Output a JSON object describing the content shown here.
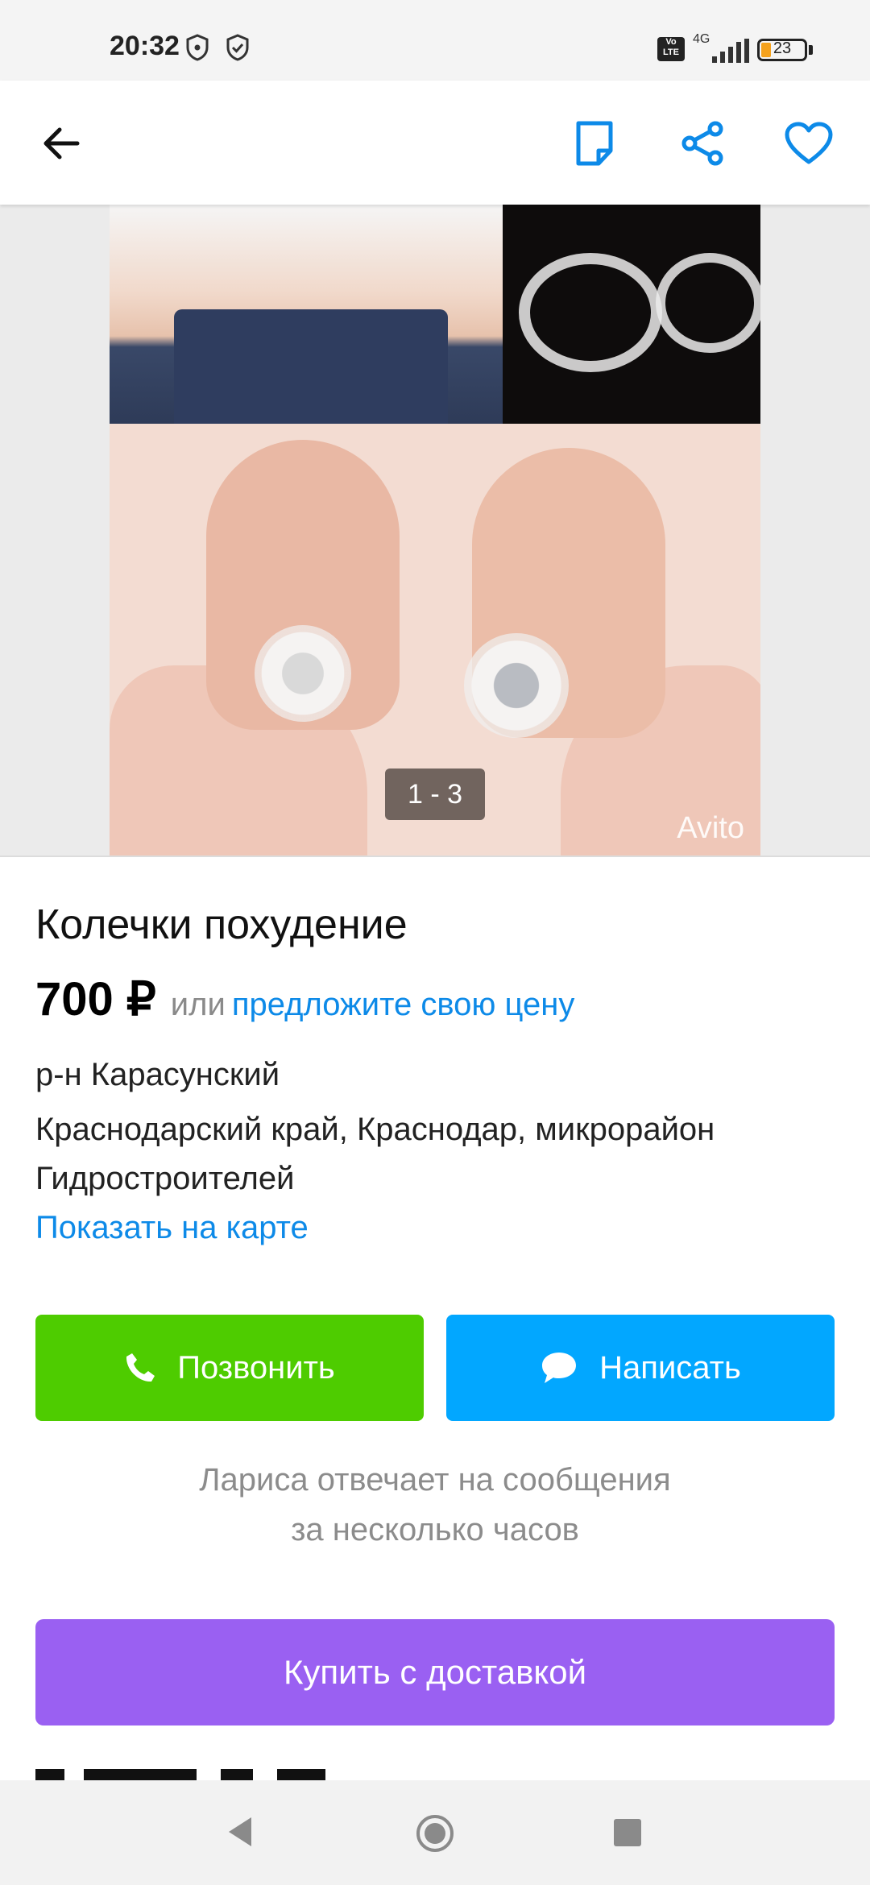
{
  "status_bar": {
    "time": "20:32",
    "network": "4G",
    "volte": "Vo LTE",
    "battery": "23",
    "battery_level": 0.23
  },
  "app_bar": {
    "icons": [
      "back-arrow-icon",
      "note-icon",
      "share-icon",
      "heart-icon"
    ],
    "accent": "#0d8ae8"
  },
  "gallery": {
    "counter": "1 - 3",
    "watermark": "Avito"
  },
  "listing": {
    "title": "Колечки похудение",
    "price": "700 ₽",
    "or_text": "или",
    "offer_link": "предложите свою цену",
    "district": "р-н Карасунский",
    "address": "Краснодарский край, Краснодар, микрорайон Гидростроителей",
    "map_link": "Показать на карте"
  },
  "actions": {
    "call_label": "Позвонить",
    "message_label": "Написать",
    "reply_note_line1": "Лариса отвечает на сообщения",
    "reply_note_line2": "за несколько часов",
    "buy_label": "Купить с доставкой",
    "colors": {
      "call": "#4ecc00",
      "message": "#02a7ff",
      "buy": "#9a60f2"
    }
  },
  "nav_bar": {
    "icons": [
      "nav-back-icon",
      "nav-home-icon",
      "nav-recent-icon"
    ]
  }
}
